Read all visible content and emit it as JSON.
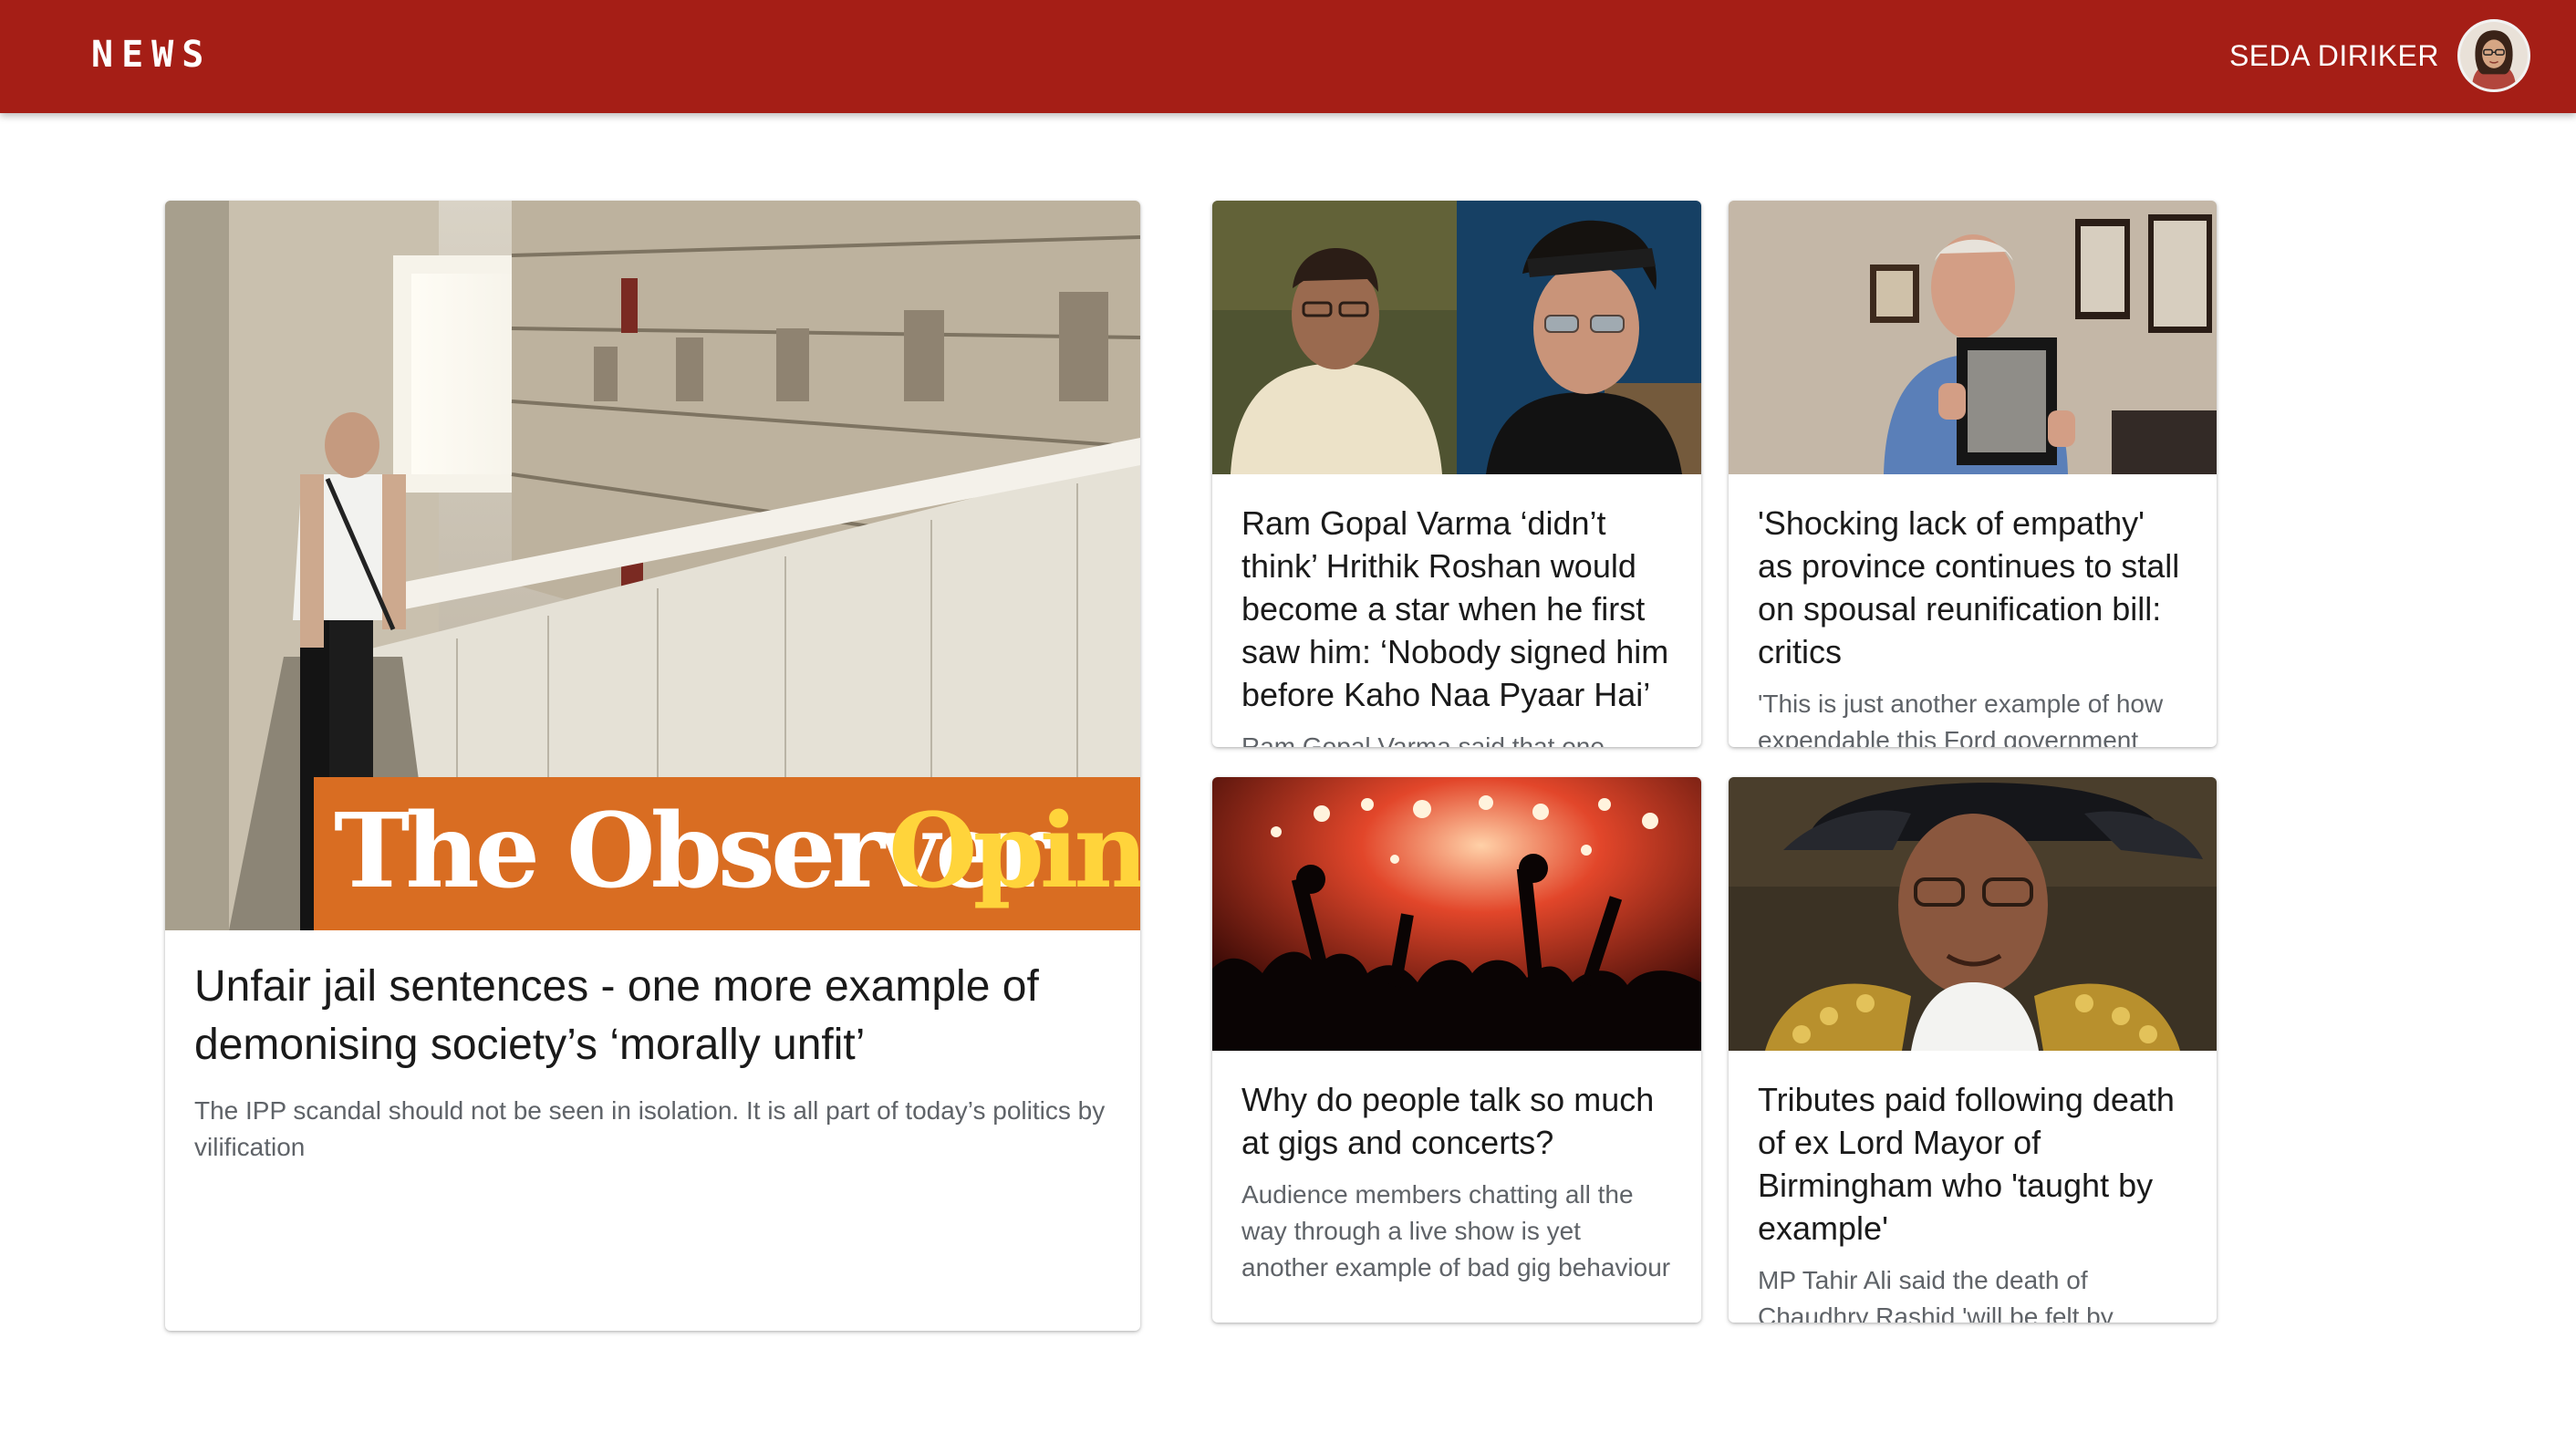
{
  "header": {
    "brand": "NEWS",
    "user_name": "SEDA DIRIKER",
    "background_color": "#a51e16"
  },
  "articles": [
    {
      "headline": "Unfair jail sentences - one more example of demonising society’s ‘morally unfit’",
      "summary": "The IPP scandal should not be seen in isolation. It is all part of today’s politics by vilification",
      "image_banner": {
        "brand": "The Observer",
        "section": "Opinion"
      }
    },
    {
      "headline": "Ram Gopal Varma ‘didn’t think’ Hrithik Roshan would become a star when he first saw him: ‘Nobody signed him before Kaho Naa Pyaar Hai’",
      "summary": "Ram Gopal Varma said that one"
    },
    {
      "headline": "'Shocking lack of empathy' as province continues to stall on spousal reunification bill: critics",
      "summary": "'This is just another example of how expendable this Ford government"
    },
    {
      "headline": "Why do people talk so much at gigs and concerts?",
      "summary": "Audience members chatting all the way through a live show is yet another example of bad gig behaviour"
    },
    {
      "headline": "Tributes paid following death of ex Lord Mayor of Birmingham who 'taught by example'",
      "summary": "MP Tahir Ali said the death of Chaudhry Rashid 'will be felt by"
    }
  ]
}
